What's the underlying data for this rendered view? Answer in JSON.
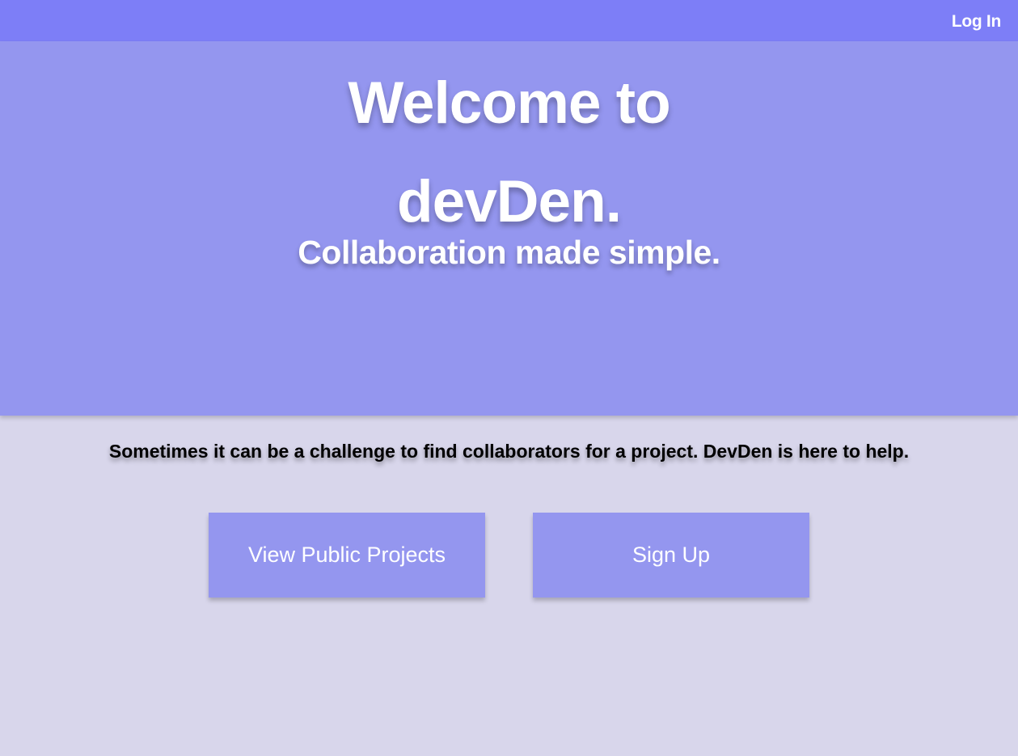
{
  "nav": {
    "login_label": "Log In"
  },
  "hero": {
    "title_line1": "Welcome to",
    "title_line2": "devDen.",
    "subtitle": "Collaboration made simple."
  },
  "main": {
    "tagline": "Sometimes it can be a challenge to find collaborators for a project. DevDen is here to help.",
    "buttons": {
      "view_projects": "View Public Projects",
      "sign_up": "Sign Up"
    }
  },
  "colors": {
    "topbar": "#7d7ef7",
    "hero": "#9496ef",
    "page_background": "#d8d6eb",
    "button": "#9496ef",
    "text_light": "#ffffff",
    "text_dark": "#000000"
  }
}
